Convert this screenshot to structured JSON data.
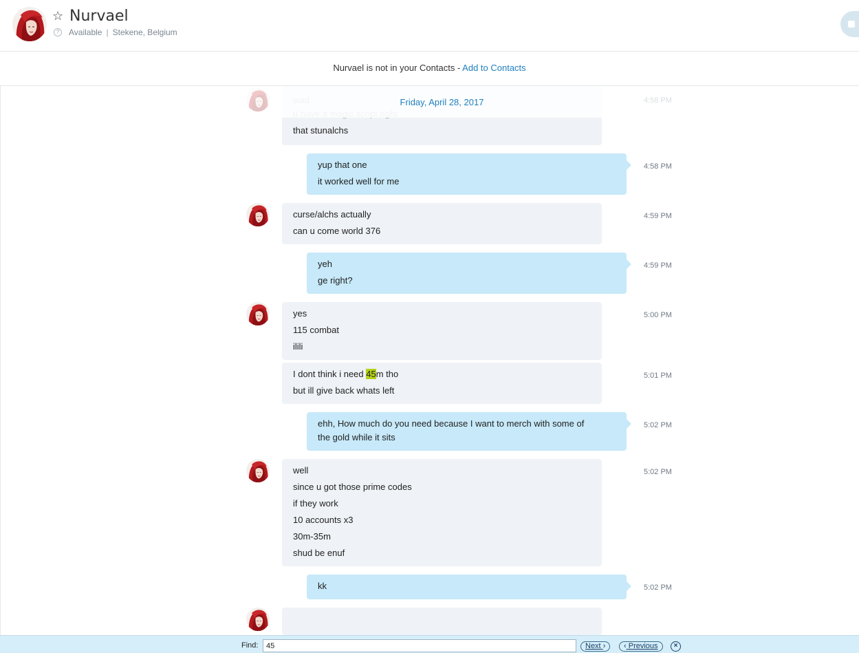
{
  "header": {
    "contact_name": "Nurvael",
    "status": "Available",
    "separator": "|",
    "location": "Stekene, Belgium",
    "star_icon": "☆",
    "status_icon": "?"
  },
  "notice": {
    "text": "Nurvael is not in your Contacts - ",
    "link": "Add to Contacts"
  },
  "date_separator": "Friday, April 28, 2017",
  "messages": [
    {
      "dir": "in",
      "time": "4:58 PM",
      "lines": [
        "wad",
        "u have a magic script right",
        "that stunalchs"
      ]
    },
    {
      "dir": "out",
      "time": "4:58 PM",
      "lines": [
        "yup that one",
        "it worked well for me"
      ]
    },
    {
      "dir": "in",
      "time": "4:59 PM",
      "lines": [
        "curse/alchs actually",
        "can u come world 376"
      ]
    },
    {
      "dir": "out",
      "time": "4:59 PM",
      "lines": [
        "yeh",
        "ge right?"
      ]
    },
    {
      "dir": "in",
      "time": "5:00 PM",
      "lines": [
        "yes",
        "115 combat",
        "ilili"
      ]
    },
    {
      "dir": "in",
      "time": "5:01 PM",
      "lines": [
        "I dont think i need ",
        "45",
        "m tho",
        "but ill give back whats left"
      ]
    },
    {
      "dir": "out",
      "time": "5:02 PM",
      "lines": [
        "ehh, How much do you need because I want to merch with some of",
        "the gold while it sits"
      ]
    },
    {
      "dir": "in",
      "time": "5:02 PM",
      "lines": [
        "well",
        "since u got those prime codes",
        "if they work",
        "10 accounts x3",
        "30m-35m",
        "shud be enuf"
      ]
    },
    {
      "dir": "out",
      "time": "5:02 PM",
      "lines": [
        "kk"
      ]
    }
  ],
  "findbar": {
    "label": "Find:",
    "value": "45",
    "next_label": "Next",
    "previous_label": "Previous",
    "close_icon": "×"
  },
  "colors": {
    "incoming_bubble": "#eff2f6",
    "outgoing_bubble": "#c7e9f9",
    "link": "#1f7fbf",
    "highlight": "#b5d118",
    "findbar_bg": "#d5eef9"
  }
}
